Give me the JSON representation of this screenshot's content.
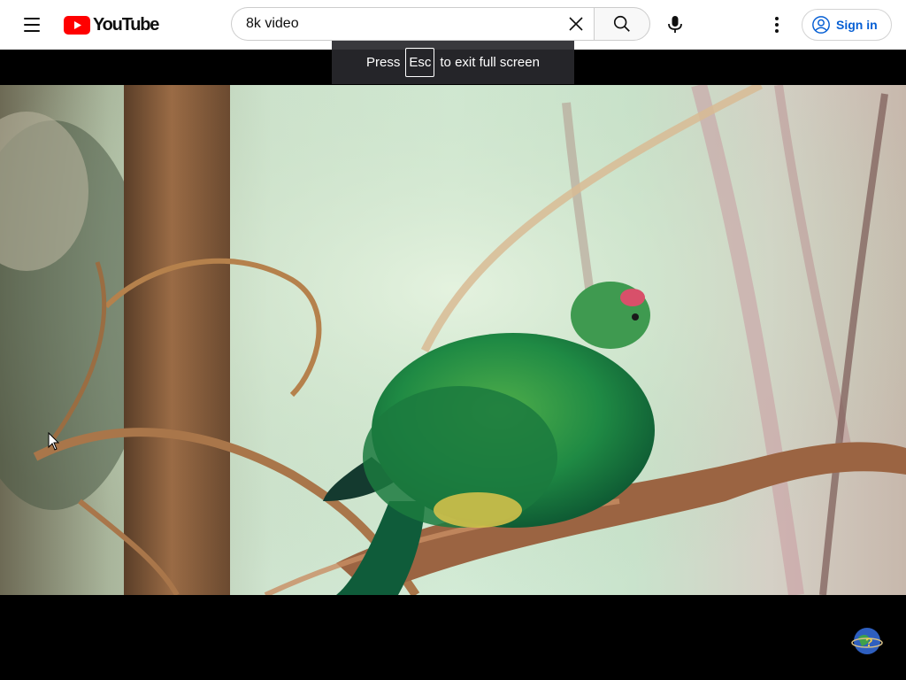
{
  "header": {
    "logo_text": "YouTube",
    "search_value": "8k video",
    "signin_label": "Sign in"
  },
  "fullscreen_toast": {
    "prefix": "Press",
    "key": "Esc",
    "suffix": "to exit full screen"
  },
  "icons": {
    "menu": "hamburger-menu-icon",
    "clear": "close-icon",
    "search": "search-icon",
    "mic": "microphone-icon",
    "more": "more-vert-icon",
    "account": "account-circle-icon"
  },
  "colors": {
    "brand_red": "#ff0000",
    "signin_blue": "#065fd4"
  }
}
